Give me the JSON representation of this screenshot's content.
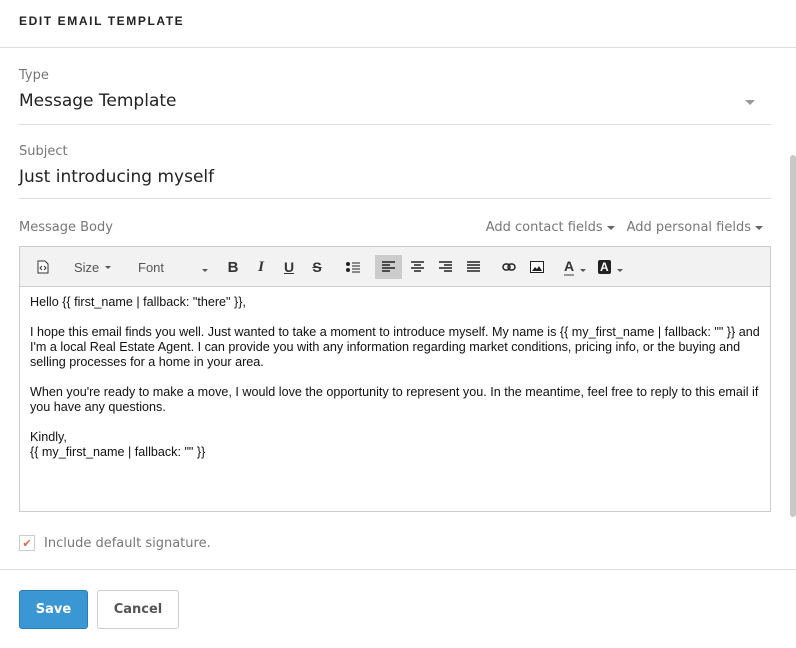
{
  "header": {
    "title": "EDIT EMAIL TEMPLATE"
  },
  "type": {
    "label": "Type",
    "value": "Message Template"
  },
  "subject": {
    "label": "Subject",
    "value": "Just introducing myself"
  },
  "message": {
    "label": "Message Body",
    "add_contact": "Add contact fields",
    "add_personal": "Add personal fields"
  },
  "toolbar": {
    "size": "Size",
    "font": "Font",
    "bold": "B",
    "italic": "I",
    "underline": "U",
    "strike": "S"
  },
  "body": {
    "p1": "Hello {{ first_name | fallback: \"there\" }},",
    "p2": "I hope this email finds you well.  Just wanted to take a moment to introduce myself.  My name is {{ my_first_name | fallback: \"\" }} and I'm a local Real Estate Agent.   I can provide you with any information regarding market conditions, pricing info, or the buying and selling processes for a home in your area.",
    "p3": "When you're ready to make a move, I would love the opportunity to represent you.  In the meantime, feel free to reply to this email if you have any questions.",
    "p4a": "Kindly,",
    "p4b": "{{ my_first_name | fallback: \"\" }}"
  },
  "signature": {
    "label": "Include default signature.",
    "checked": true
  },
  "buttons": {
    "save": "Save",
    "cancel": "Cancel"
  },
  "colors": {
    "primary": "#3a97d4",
    "check": "#e8604c"
  }
}
